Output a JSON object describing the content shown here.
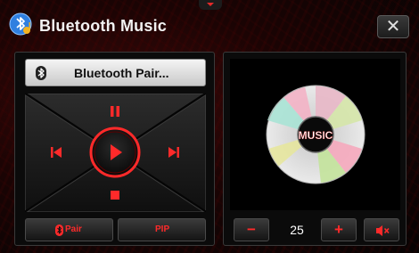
{
  "window": {
    "title": "Bluetooth Music",
    "close_symbol": "✕"
  },
  "left_panel": {
    "device_label": "Bluetooth Pair...",
    "buttons": {
      "pair_label": "Pair",
      "pip_label": "PIP"
    }
  },
  "right_panel": {
    "disc_label": "MUSIC",
    "volume": {
      "minus_symbol": "−",
      "value": "25",
      "plus_symbol": "+"
    }
  },
  "colors": {
    "accent": "#ff2a2a",
    "background": "#1a0404",
    "panel": "#0b0b0b"
  },
  "icons": [
    "app-bluetooth-music-icon",
    "bluetooth-icon",
    "pause-icon",
    "previous-icon",
    "play-icon",
    "next-icon",
    "stop-icon",
    "mute-icon"
  ]
}
